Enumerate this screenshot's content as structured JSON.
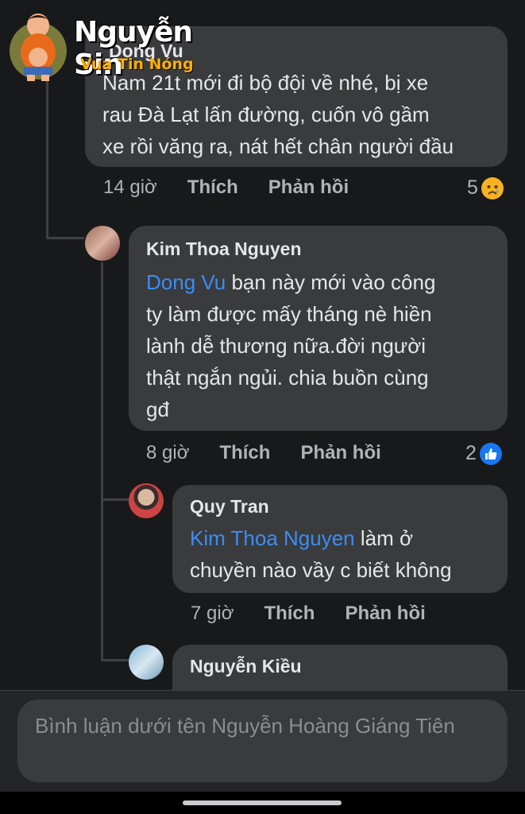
{
  "watermark": {
    "title": "Nguyễn Sin",
    "subtitle": "Vua Tin Nóng"
  },
  "comments": [
    {
      "author": "Dong Vu",
      "text": "Nam 21t mới đi bộ đội về nhé, bị xe\nrau Đà Lạt lấn đường, cuốn vô gầm\nxe rồi văng ra, nát hết chân người đầu",
      "time": "14 giờ",
      "like": "Thích",
      "reply": "Phản hồi",
      "reaction_count": "5",
      "reaction_icon": "sad-icon"
    },
    {
      "author": "Kim Thoa Nguyen",
      "mention": "Dong Vu",
      "text": " bạn này mới vào công\nty làm được mấy tháng nè hiền\nlành dễ thương nữa.đời người\nthật ngắn ngủi. chia buồn cùng\ngđ",
      "time": "8 giờ",
      "like": "Thích",
      "reply": "Phản hồi",
      "reaction_count": "2",
      "reaction_icon": "like-icon"
    },
    {
      "author": "Quy Tran",
      "mention": "Kim Thoa Nguyen",
      "text": " làm ở\nchuyền nào vầy c biết không",
      "time": "7 giờ",
      "like": "Thích",
      "reply": "Phản hồi"
    },
    {
      "author": "Nguyễn Kiều"
    }
  ],
  "composer": {
    "placeholder": "Bình luận dưới tên Nguyễn Hoàng Giáng Tiên"
  },
  "colors": {
    "background": "#18191a",
    "bubble": "#3a3b3c",
    "mention": "#3b8df5",
    "like_blue": "#1877f2"
  }
}
